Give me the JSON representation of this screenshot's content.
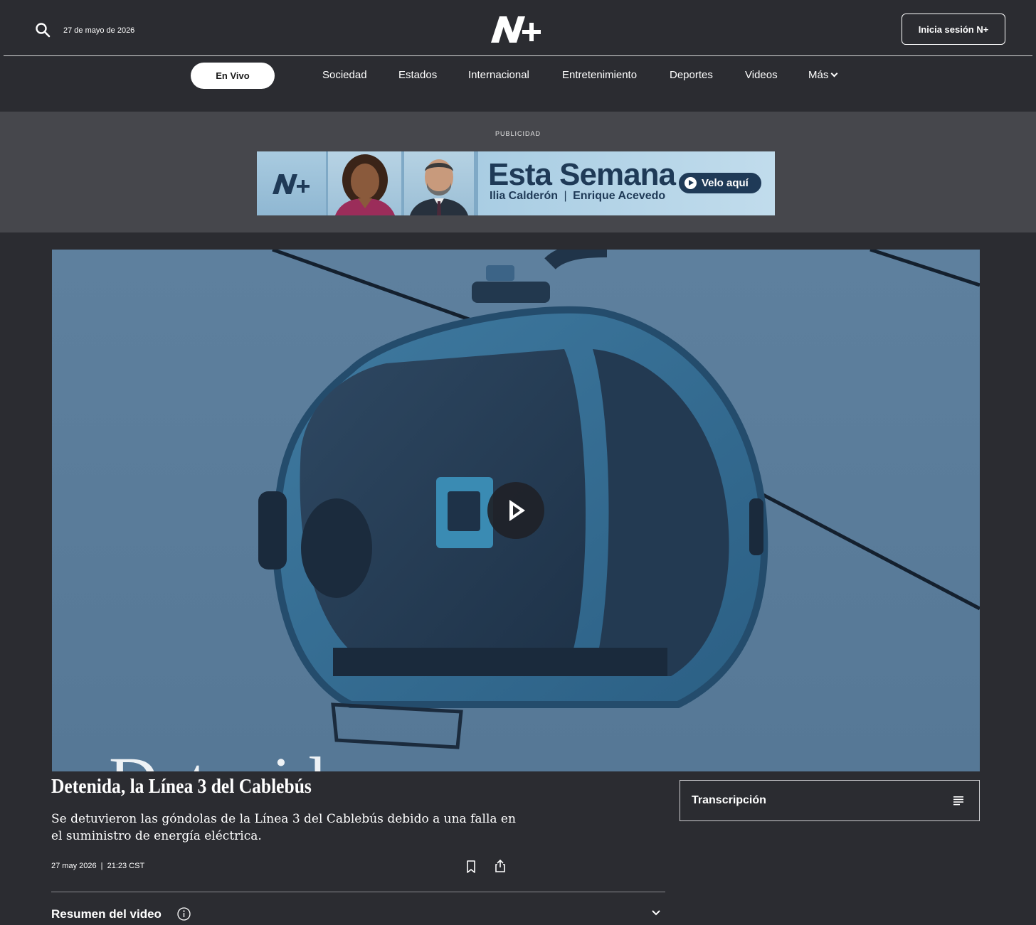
{
  "header": {
    "date": "27 de mayo de 2026",
    "logo_alt": "N+",
    "login_label": "Inicia sesión N+"
  },
  "nav": {
    "live_label": "En Vivo",
    "items": [
      "Sociedad",
      "Estados",
      "Internacional",
      "Entretenimiento",
      "Deportes",
      "Videos",
      "Más"
    ]
  },
  "ad": {
    "label": "PUBLICIDAD",
    "title": "Esta Semana",
    "hosts_left": "Ilia Calderón",
    "hosts_sep": "|",
    "hosts_right": "Enrique Acevedo",
    "cta": "Velo aquí"
  },
  "video": {
    "overlay_text": "Detenida"
  },
  "article": {
    "headline": "Detenida, la Línea 3 del Cablebús",
    "summary": "Se detuvieron las góndolas de la Línea 3 del Cablebús debido a una falla en el suministro de energía eléctrica.",
    "date": "27 may 2026",
    "meta_sep": "|",
    "time": "21:23 CST",
    "resumen_label": "Resumen del video"
  },
  "transcript": {
    "label": "Transcripción"
  },
  "icons": {
    "search": "search-icon",
    "bookmark": "bookmark-icon",
    "share": "share-icon",
    "info": "info-icon",
    "chevron": "chevron-down-icon",
    "transcript": "list-lines-icon",
    "play": "play-icon"
  },
  "colors": {
    "page_bg": "#2b2c31",
    "ad_bg": "#46474c",
    "ad_navy": "#1f3a57",
    "video_tint": "#5b7d9c"
  }
}
